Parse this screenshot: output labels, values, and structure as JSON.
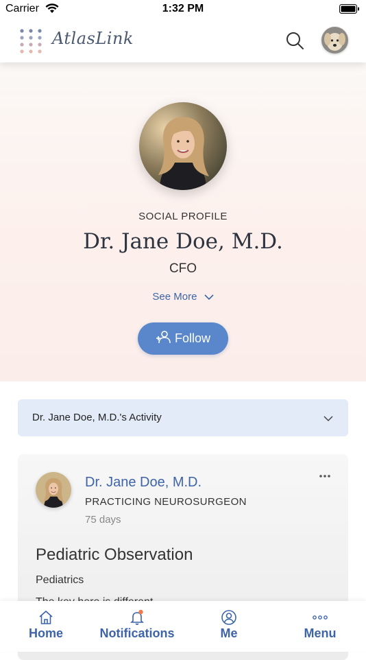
{
  "status_bar": {
    "carrier": "Carrier",
    "time": "1:32 PM"
  },
  "header": {
    "brand": "AtlasLink",
    "icons": {
      "search": "search-icon",
      "avatar": "user-avatar"
    }
  },
  "profile": {
    "eyebrow": "SOCIAL PROFILE",
    "name": "Dr. Jane Doe, M.D.",
    "title": "CFO",
    "see_more_label": "See More",
    "follow_label": "Follow"
  },
  "activity": {
    "label": "Dr. Jane Doe, M.D.'s Activity"
  },
  "post": {
    "author": "Dr. Jane Doe, M.D.",
    "role": "PRACTICING NEUROSURGEON",
    "time": "75 days",
    "title": "Pediatric Observation",
    "category": "Pediatrics",
    "body_visible": "The key here is different... ."
  },
  "tab_bar": {
    "items": [
      {
        "label": "Home",
        "icon": "home-icon"
      },
      {
        "label": "Notifications",
        "icon": "bell-icon"
      },
      {
        "label": "Me",
        "icon": "person-icon"
      },
      {
        "label": "Menu",
        "icon": "more-icon"
      }
    ]
  },
  "colors": {
    "accent": "#3d63a8",
    "follow_button": "#5a87cc",
    "activity_bar": "#e3ebf8",
    "notification_dot": "#f07a4a"
  }
}
